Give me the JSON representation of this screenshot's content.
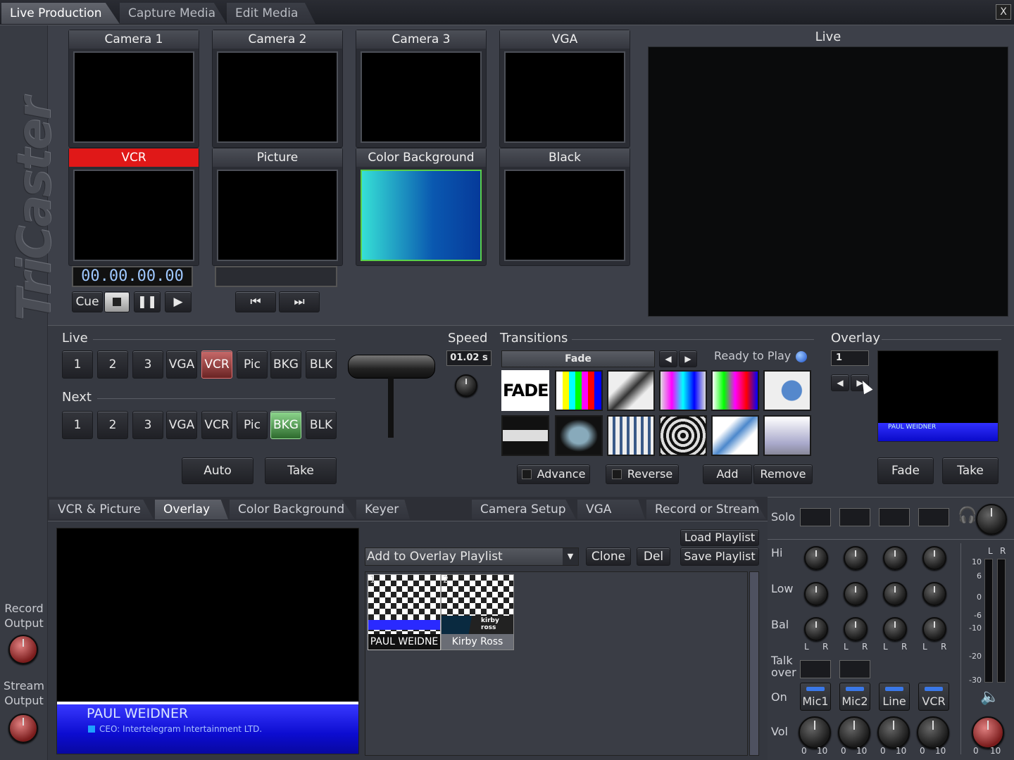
{
  "tabs": [
    {
      "label": "Live Production",
      "active": true
    },
    {
      "label": "Capture Media",
      "active": false
    },
    {
      "label": "Edit Media",
      "active": false
    }
  ],
  "close_label": "X",
  "sidebar": {
    "logo": "TriCaster",
    "record_output": "Record\nOutput",
    "stream_output": "Stream\nOutput"
  },
  "sources": [
    {
      "label": "Camera 1"
    },
    {
      "label": "Camera 2"
    },
    {
      "label": "Camera 3"
    },
    {
      "label": "VGA"
    },
    {
      "label": "VCR",
      "active": true
    },
    {
      "label": "Picture"
    },
    {
      "label": "Color Background"
    },
    {
      "label": "Black"
    }
  ],
  "vcr": {
    "timecode": "00.00.00.00",
    "cue": "Cue"
  },
  "live_label": "Live",
  "switcher": {
    "live_label": "Live",
    "next_label": "Next",
    "buttons": [
      "1",
      "2",
      "3",
      "VGA",
      "VCR",
      "Pic",
      "BKG",
      "BLK"
    ],
    "auto": "Auto",
    "take": "Take",
    "speed_label": "Speed",
    "speed_value": "01.02 s"
  },
  "transitions": {
    "label": "Transitions",
    "selected": "Fade",
    "status": "Ready to Play",
    "advance": "Advance",
    "reverse": "Reverse",
    "add": "Add",
    "remove": "Remove",
    "first_thumb_text": "FADE"
  },
  "overlay": {
    "label": "Overlay",
    "number": "1",
    "fade": "Fade",
    "take": "Take",
    "mini_text": "PAUL WEIDNER"
  },
  "bottom_tabs": [
    {
      "label": "VCR & Picture",
      "active": false
    },
    {
      "label": "Overlay",
      "active": true
    },
    {
      "label": "Color Background",
      "active": false
    },
    {
      "label": "Keyer",
      "active": false
    },
    {
      "label": "Camera Setup",
      "active": false
    },
    {
      "label": "VGA",
      "active": false
    },
    {
      "label": "Record or Stream",
      "active": false
    }
  ],
  "overlay_preview": {
    "name": "PAUL WEIDNER",
    "title": "CEO: Intertelegram Intertainment LTD."
  },
  "playlist": {
    "dropdown": "Add to Overlay Playlist",
    "clone": "Clone",
    "del": "Del",
    "load": "Load Playlist",
    "save": "Save Playlist",
    "items": [
      {
        "num": "1",
        "caption": "PAUL WEIDNE",
        "selected": true
      },
      {
        "num": "2",
        "caption": "Kirby Ross",
        "selected": false
      }
    ],
    "item2_overlay_text": "kirby ross"
  },
  "mixer": {
    "solo": "Solo",
    "hi": "Hi",
    "low": "Low",
    "bal": "Bal",
    "talkover": "Talk\nover",
    "on": "On",
    "vol": "Vol",
    "channels": [
      "Mic1",
      "Mic2",
      "Line",
      "VCR"
    ],
    "lr_l": "L",
    "lr_r": "R",
    "vol_min": "0",
    "vol_max": "10",
    "meter_ticks": [
      "10",
      "6",
      "0",
      "-6",
      "-10",
      "-20",
      "-30"
    ]
  }
}
